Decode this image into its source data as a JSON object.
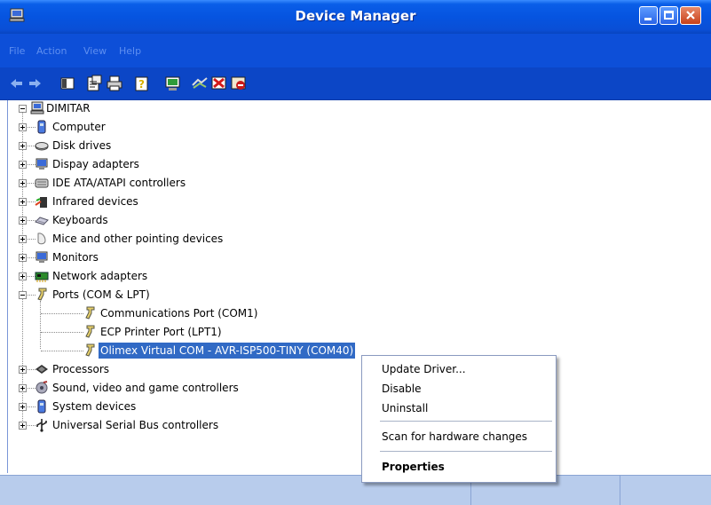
{
  "window": {
    "title": "Device Manager"
  },
  "menu": [
    "File",
    "Action",
    "View",
    "Help"
  ],
  "toolbar": {
    "buttons": [
      "back-arrow-icon",
      "forward-arrow-icon",
      "show-hide-console-tree-icon",
      "properties-icon",
      "print-icon",
      "help-icon",
      "update-driver-icon",
      "scan-hardware-icon",
      "uninstall-icon",
      "disable-icon"
    ]
  },
  "tree": {
    "root": "DIMITAR",
    "categories": [
      "Computer",
      "Disk drives",
      "Dispay adapters",
      "IDE ATA/ATAPI controllers",
      "Infrared devices",
      "Keyboards",
      "Mice and other pointing devices",
      "Monitors",
      "Network adapters",
      "Ports (COM & LPT)"
    ],
    "ports_children": [
      "Communications Port (COM1)",
      "ECP Printer Port (LPT1)",
      "Olimex Virtual COM - AVR-ISP500-TINY (COM40)"
    ],
    "categories_after": [
      "Processors",
      "Sound, video and game controllers",
      "System devices",
      "Universal Serial Bus controllers"
    ]
  },
  "context_menu": {
    "items": [
      "Update Driver...",
      "Disable",
      "Uninstall"
    ],
    "scan": "Scan for hardware changes",
    "properties": "Properties"
  },
  "colors": {
    "titlebar": "#0654e0",
    "selection": "#316ac5",
    "statusbar": "#b8ccec"
  }
}
